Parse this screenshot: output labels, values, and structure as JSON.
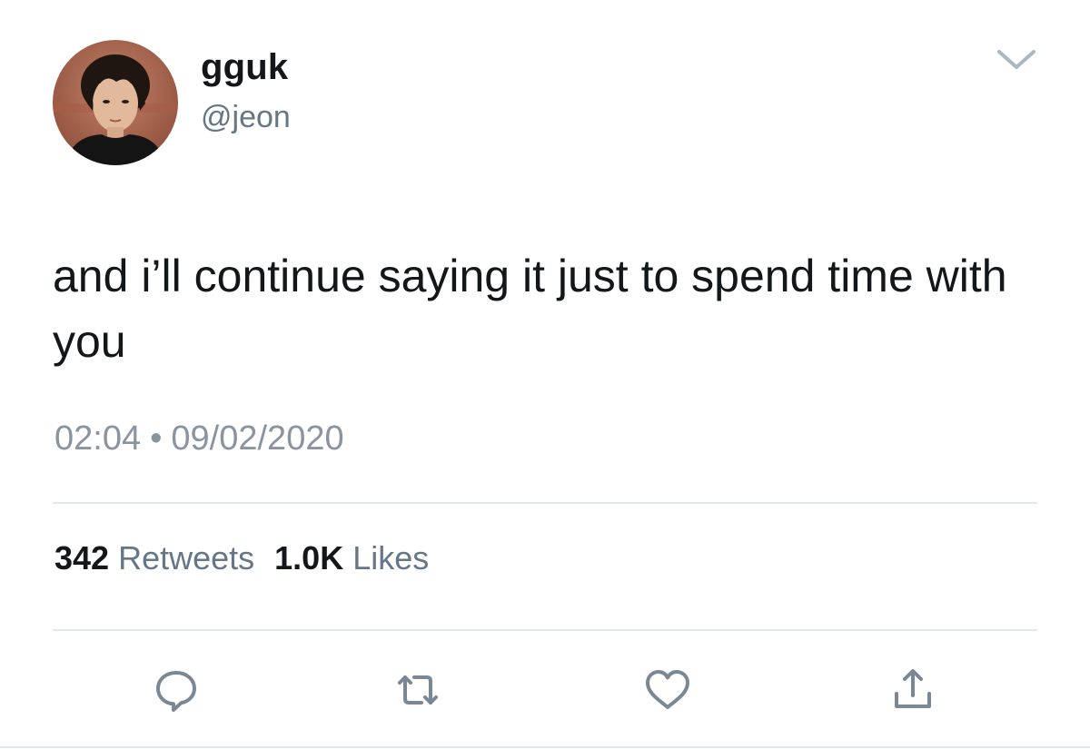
{
  "user": {
    "display_name": "gguk",
    "handle": "@jeon",
    "avatar": "profile-photo"
  },
  "tweet": {
    "text": "and i’ll continue saying it just to spend time with you",
    "time": "02:04",
    "separator": "•",
    "date": "09/02/2020"
  },
  "stats": {
    "retweets_count": "342",
    "retweets_label": "Retweets",
    "likes_count": "1.0K",
    "likes_label": "Likes"
  },
  "actions": {
    "reply_icon": "reply-icon",
    "retweet_icon": "retweet-icon",
    "like_icon": "heart-icon",
    "share_icon": "share-icon"
  },
  "colors": {
    "text": "#14171a",
    "secondary": "#657786",
    "divider": "#e1e8ed",
    "icon": "#7a8895"
  }
}
